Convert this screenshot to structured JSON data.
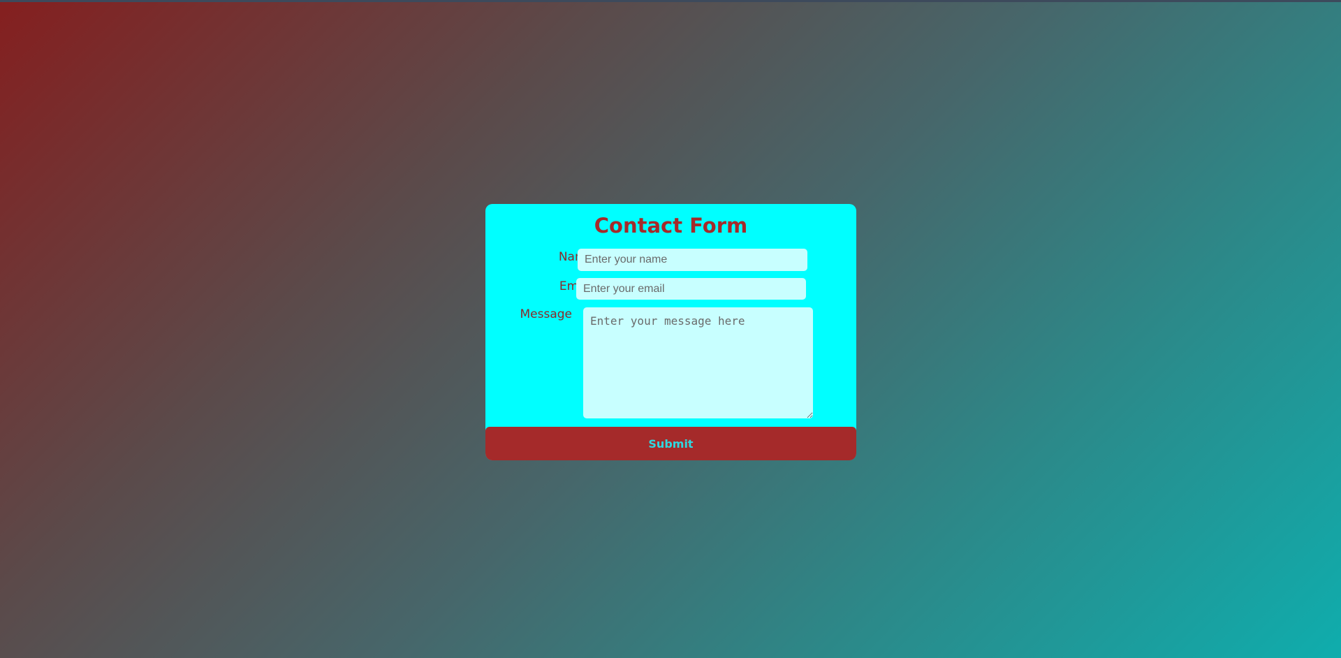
{
  "form": {
    "title": "Contact Form",
    "fields": {
      "name": {
        "label": "Name",
        "placeholder": "Enter your name",
        "value": ""
      },
      "email": {
        "label": "Email",
        "placeholder": "Enter your email",
        "value": ""
      },
      "message": {
        "label": "Message",
        "placeholder": "Enter your message here",
        "value": ""
      }
    },
    "submit_label": "Submit"
  },
  "colors": {
    "card_background": "#00ffff",
    "title": "#a52a2a",
    "button_background": "#a52a2a",
    "button_text": "#2fd8e0",
    "field_background": "#c8ffff"
  }
}
